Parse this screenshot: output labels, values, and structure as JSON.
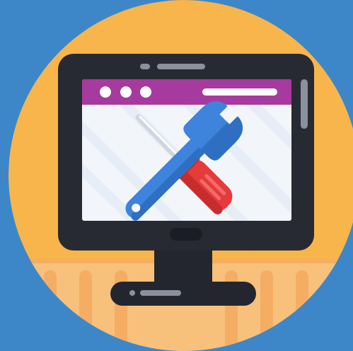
{
  "colors": {
    "background": "#3d87c9",
    "circle": "#f8b54b",
    "circle_stripe": "#f3a93e",
    "desk": "#f7c17b",
    "desk_leg": "#f4ad62",
    "monitor_frame": "#272a33",
    "monitor_frame_dark": "#1b1d24",
    "screen": "#f2f6fb",
    "screen_stripe": "#e6edf6",
    "titlebar": "#a63a9e",
    "titlebar_dot": "#ffffff",
    "wrench": "#3e83dc",
    "wrench_shadow": "#2f6fc2",
    "screwdriver_handle": "#e63b3b",
    "screwdriver_handle_dark": "#c92c2c",
    "screwdriver_shaft": "#cfd6df",
    "stand": "#23262e",
    "detail_grey": "#8a909c"
  },
  "icons": {
    "main": "repair-tools-monitor-icon",
    "wrench": "wrench-icon",
    "screwdriver": "screwdriver-icon"
  }
}
